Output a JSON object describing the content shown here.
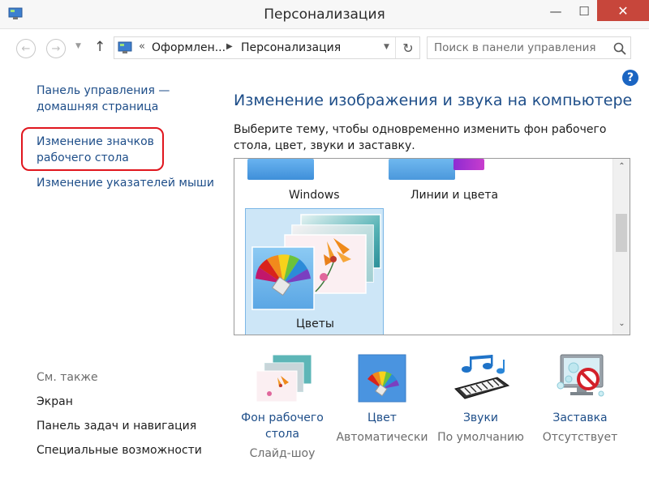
{
  "window": {
    "title": "Персонализация",
    "minimize": "—",
    "maximize": "☐",
    "close": "✕"
  },
  "nav": {
    "back": "←",
    "forward": "→",
    "history_dropdown": "▼",
    "up": "↑",
    "breadcrumb": {
      "overflow": "«",
      "items": [
        "Оформлен...",
        "Персонализация"
      ],
      "separator": "▶"
    },
    "address_dropdown": "▼",
    "refresh": "↻",
    "search_placeholder": "Поиск в панели управления"
  },
  "help": "?",
  "sidebar": {
    "home_link": "Панель управления — домашняя страница",
    "links": [
      "Изменение значков рабочего стола",
      "Изменение указателей мыши"
    ],
    "see_also_label": "См. также",
    "see_also": [
      "Экран",
      "Панель задач и навигация",
      "Специальные возможности"
    ]
  },
  "main": {
    "heading": "Изменение изображения и звука на компьютере",
    "description": "Выберите тему, чтобы одновременно изменить фон рабочего стола, цвет, звуки и заставку.",
    "themes": [
      {
        "label": "Windows"
      },
      {
        "label": "Линии и цвета"
      },
      {
        "label": "Цветы",
        "selected": true
      }
    ],
    "scroll_up": "⌃",
    "scroll_down": "⌄"
  },
  "settings": [
    {
      "link": "Фон рабочего стола",
      "sub": "Слайд-шоу",
      "icon": "desktop-background-icon"
    },
    {
      "link": "Цвет",
      "sub": "Автоматически",
      "icon": "color-palette-icon"
    },
    {
      "link": "Звуки",
      "sub": "По умолчанию",
      "icon": "sounds-icon"
    },
    {
      "link": "Заставка",
      "sub": "Отсутствует",
      "icon": "screensaver-icon"
    }
  ],
  "colors": {
    "link": "#1e4e89",
    "close_button": "#c7463b",
    "selection": "#cde6f7",
    "highlight": "#e0161e"
  }
}
